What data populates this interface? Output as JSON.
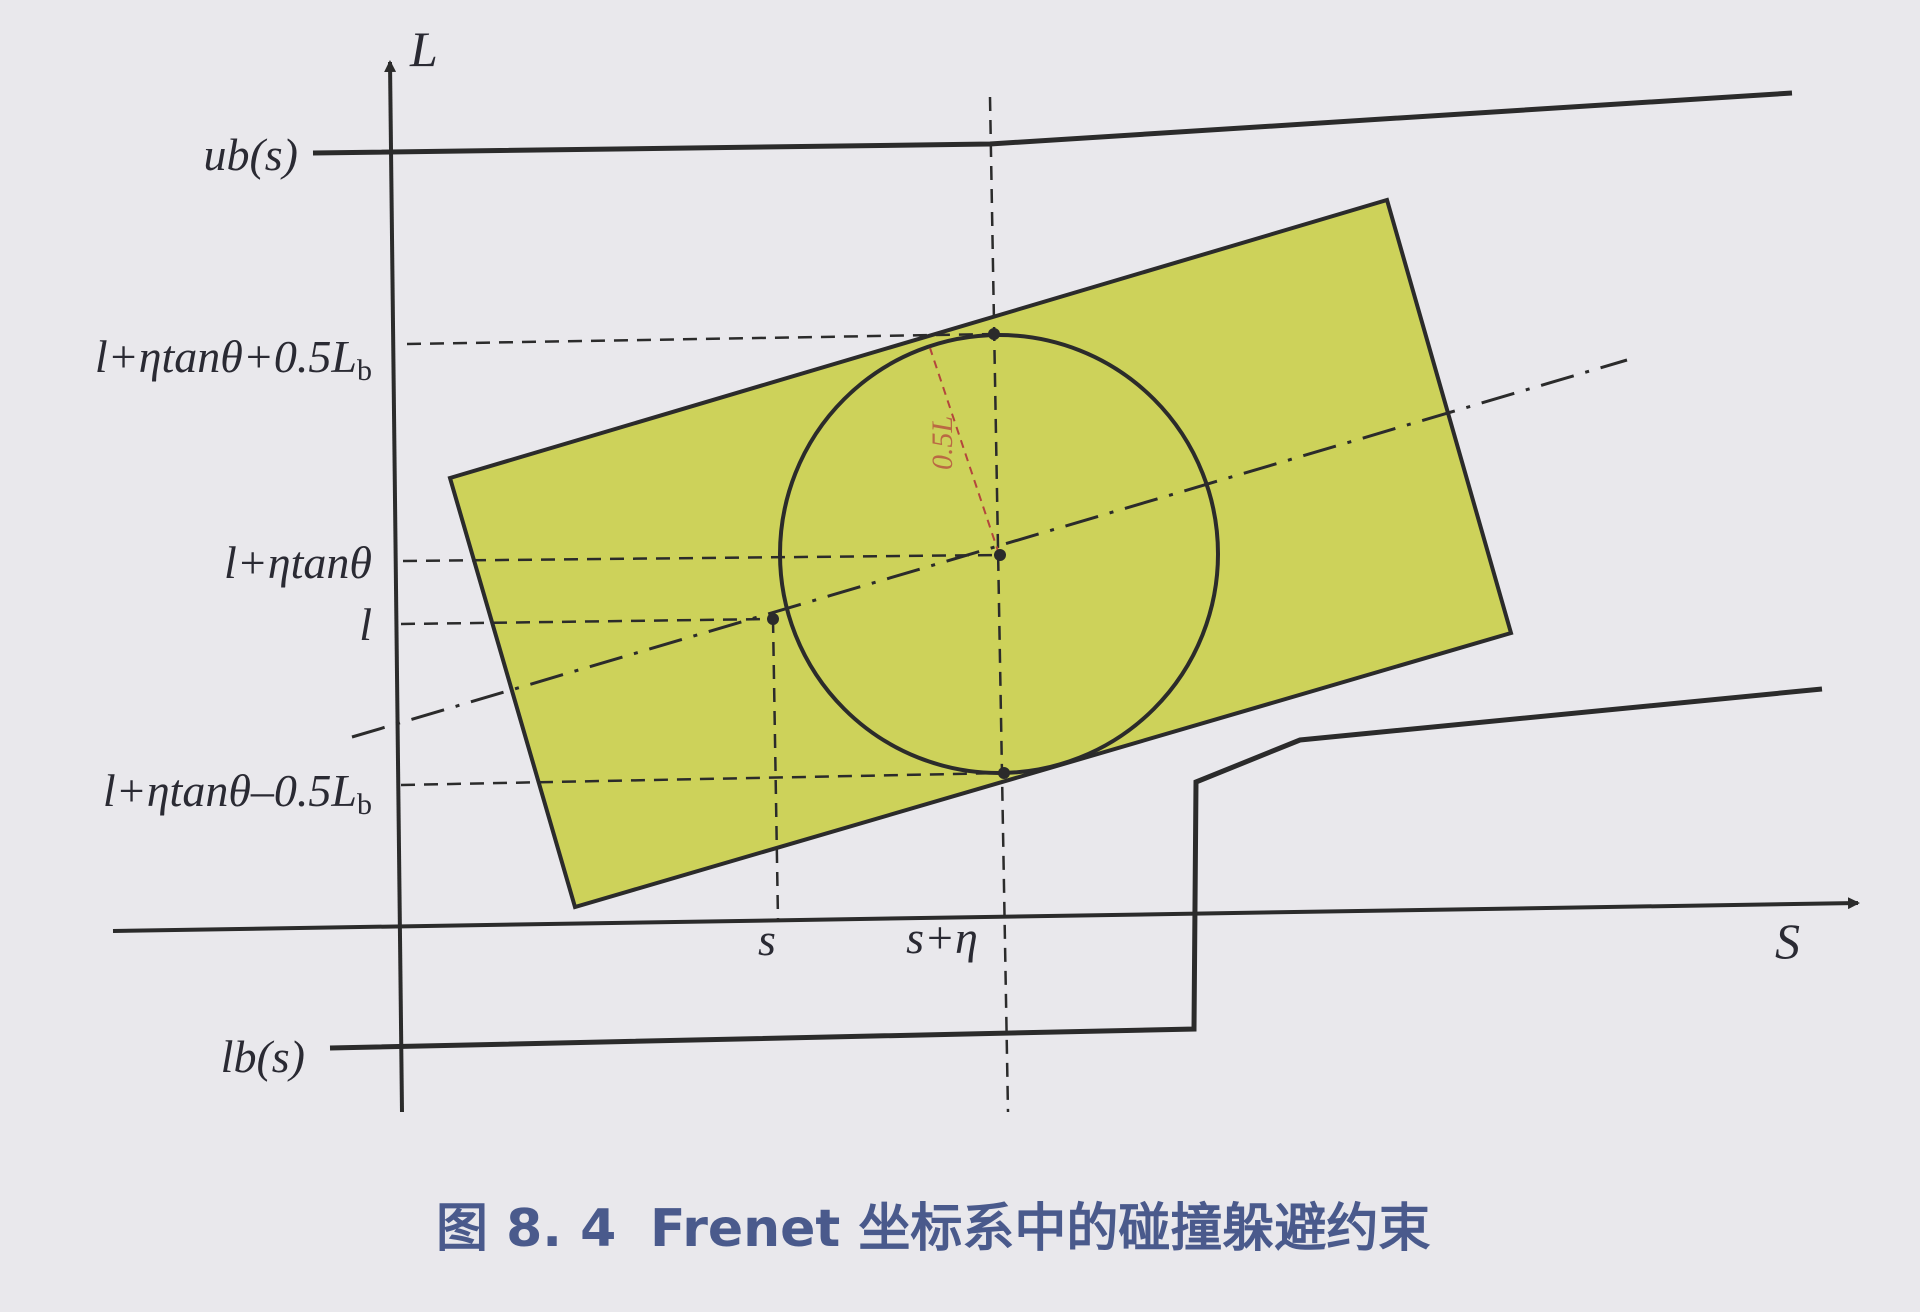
{
  "axes": {
    "vertical": "L",
    "horizontal": "S"
  },
  "boundaries": {
    "upper": "ub(s)",
    "lower": "lb(s)"
  },
  "y_labels": {
    "top": "l+ηtanθ+0.5L",
    "top_sub": "b",
    "center": "l+ηtanθ",
    "l": "l",
    "bottom": "l+ηtanθ–0.5L",
    "bottom_sub": "b"
  },
  "x_labels": {
    "s": "s",
    "s_eta": "s+η"
  },
  "radius_annotation": "0.5L",
  "caption": {
    "number": "图 8. 4",
    "text": "Frenet 坐标系中的碰撞躲避约束"
  },
  "colors": {
    "vehicle_fill": "#cdd25a",
    "line": "#2b2b2b",
    "background": "#e9e8ec",
    "caption": "#4a5a8c",
    "annotation": "#b4463c"
  }
}
